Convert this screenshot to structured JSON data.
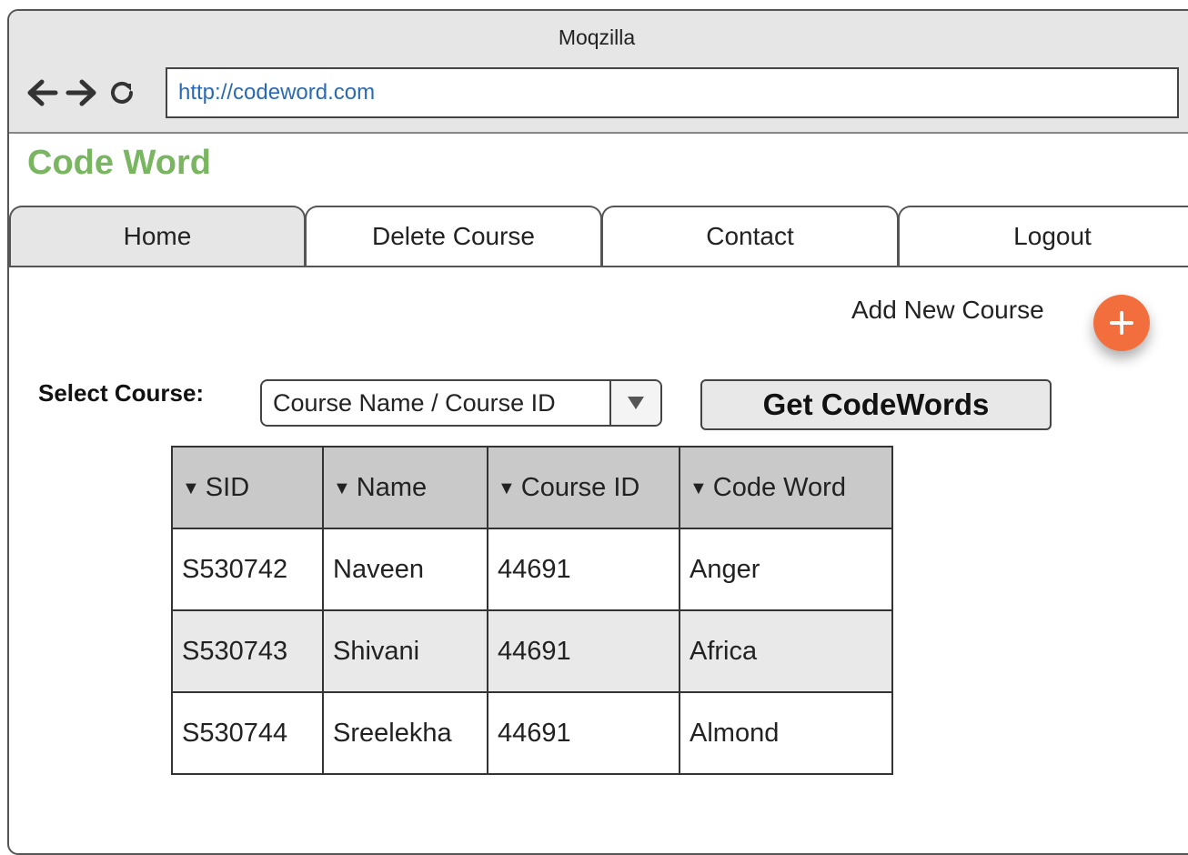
{
  "browser": {
    "title": "Moqzilla",
    "url": "http://codeword.com",
    "icons": [
      "back-arrow-icon",
      "forward-arrow-icon",
      "reload-icon"
    ]
  },
  "site": {
    "brand": "Code Word",
    "brand_color": "#7ab661"
  },
  "tabs": [
    {
      "label": "Home",
      "active": true
    },
    {
      "label": "Delete Course",
      "active": false
    },
    {
      "label": "Contact",
      "active": false
    },
    {
      "label": "Logout",
      "active": false
    }
  ],
  "actions": {
    "add_course_label": "Add New Course",
    "add_icon": "plus-icon",
    "accent_color": "#f36e3d"
  },
  "filter": {
    "select_label": "Select Course:",
    "dropdown_value": "Course Name / Course ID",
    "dropdown_icon": "dropdown-triangle-icon",
    "button_label": "Get CodeWords"
  },
  "table": {
    "sort_icon": "sort-triangle-icon",
    "columns": [
      "SID",
      "Name",
      "Course ID",
      "Code Word"
    ],
    "rows": [
      [
        "S530742",
        "Naveen",
        "44691",
        "Anger"
      ],
      [
        "S530743",
        "Shivani",
        "44691",
        "Africa"
      ],
      [
        "S530744",
        "Sreelekha",
        "44691",
        "Almond"
      ]
    ]
  }
}
